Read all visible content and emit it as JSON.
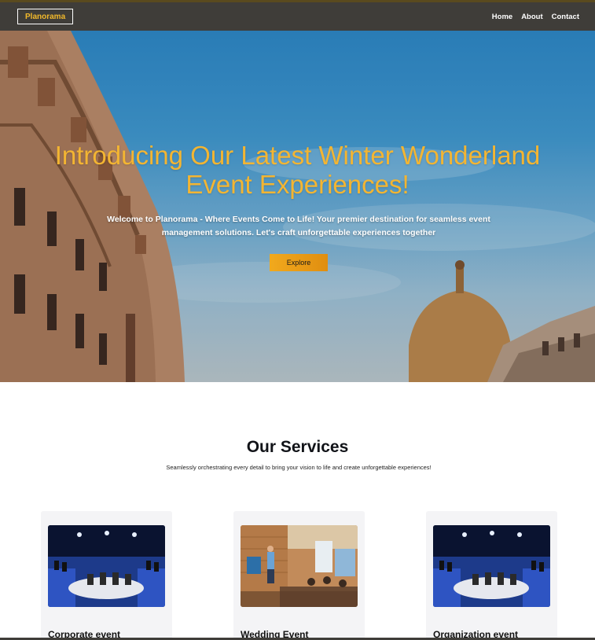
{
  "navbar": {
    "brand": "Planorama",
    "links": [
      "Home",
      "About",
      "Contact"
    ]
  },
  "hero": {
    "title_line1": "Introducing Our Latest Winter Wonderland",
    "title_line2": "Event Experiences!",
    "subtitle": "Welcome to Planorama - Where Events Come to Life! Your premier destination for seamless event management solutions. Let's craft unforgettable experiences together",
    "button_label": "Explore"
  },
  "services": {
    "title": "Our Services",
    "subtitle": "Seamlessly orchestrating every detail to bring your vision to life and create unforgettable experiences!",
    "cards": [
      {
        "title": "Corporate event",
        "image": "conference-stage-image"
      },
      {
        "title": "Wedding Event",
        "image": "presentation-room-image"
      },
      {
        "title": "Organization event",
        "image": "conference-stage-image"
      }
    ]
  },
  "colors": {
    "navbar_bg": "#3f3d39",
    "accent": "#f3b532",
    "button": "#f1a91d"
  }
}
